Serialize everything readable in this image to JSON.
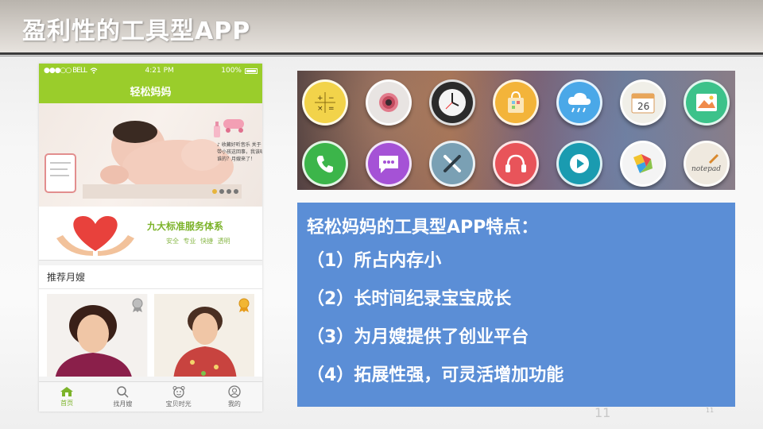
{
  "slide": {
    "title": "盈利性的工具型APP",
    "page_number": "11",
    "page_number_small": "11"
  },
  "phone": {
    "status_carrier": "●●●○○ BELL",
    "status_time": "4:21 PM",
    "status_battery": "100%",
    "nav_title": "轻松妈妈",
    "banner_text": "♪ 收藏好听音乐 关于带小孩这回事，我该听谁的？月嫂来了！",
    "service_title": "九大标准服务体系",
    "service_tags": "安全 专业 快捷 透明",
    "recommend_header": "推荐月嫂",
    "tabs": [
      {
        "label": "首页",
        "icon": "home-icon",
        "active": true
      },
      {
        "label": "找月嫂",
        "icon": "search-icon",
        "active": false
      },
      {
        "label": "宝贝时光",
        "icon": "baby-icon",
        "active": false
      },
      {
        "label": "我的",
        "icon": "user-icon",
        "active": false
      }
    ]
  },
  "app_icons": [
    {
      "name": "calculator-icon",
      "color": "#f2d34a"
    },
    {
      "name": "camera-icon",
      "color": "#e8e4e2"
    },
    {
      "name": "clock-icon",
      "color": "#2b2b2b"
    },
    {
      "name": "store-icon",
      "color": "#f3b43a"
    },
    {
      "name": "weather-icon",
      "color": "#4aa8e8"
    },
    {
      "name": "calendar-icon",
      "color": "#f0efe8",
      "text": "26"
    },
    {
      "name": "gallery-icon",
      "color": "#3cc28a"
    },
    {
      "name": "phone-icon",
      "color": "#3cb54a"
    },
    {
      "name": "message-icon",
      "color": "#a552d6"
    },
    {
      "name": "settings-icon",
      "color": "#7aa0b4"
    },
    {
      "name": "music-icon",
      "color": "#e8545a"
    },
    {
      "name": "video-icon",
      "color": "#1a9bb0"
    },
    {
      "name": "app-store-icon",
      "color": "#f4f4f4"
    },
    {
      "name": "notepad-icon",
      "color": "#efe9df",
      "text": "notepad"
    }
  ],
  "features": {
    "title": "轻松妈妈的工具型APP特点：",
    "items": [
      "（1）所占内存小",
      "（2）长时间纪录宝宝成长",
      "（3）为月嫂提供了创业平台",
      "（4）拓展性强，可灵活增加功能"
    ]
  },
  "colors": {
    "phone_green": "#9acd2b",
    "feature_blue": "#5b8ed6",
    "service_green": "#7cb32a"
  }
}
